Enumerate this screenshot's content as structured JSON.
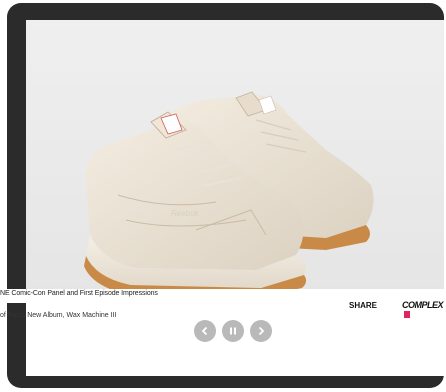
{
  "ticker": {
    "line1": "NE Comic-Con Panel and First Episode Impressions",
    "line2": "of Posts New Album, Wax Machine III"
  },
  "share_label": "SHARE",
  "brand_label": "COMPLEX",
  "controls": {
    "prev_icon": "chevron-left-icon",
    "pause_icon": "pause-icon",
    "next_icon": "chevron-right-icon"
  },
  "colors": {
    "frame": "#2b2b2b",
    "control": "#b9b9b9",
    "brand_accent": "#e0245e"
  }
}
